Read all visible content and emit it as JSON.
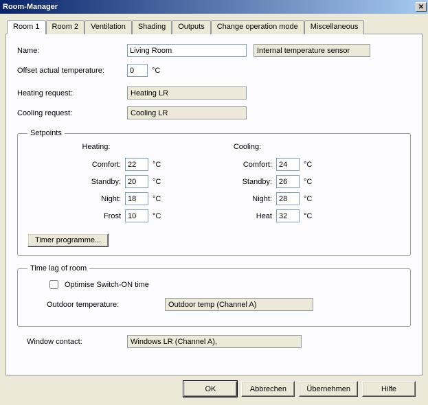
{
  "window": {
    "title": "Room-Manager"
  },
  "tabs": [
    {
      "label": "Room 1"
    },
    {
      "label": "Room 2"
    },
    {
      "label": "Ventilation"
    },
    {
      "label": "Shading"
    },
    {
      "label": "Outputs"
    },
    {
      "label": "Change operation mode"
    },
    {
      "label": "Miscellaneous"
    }
  ],
  "fields": {
    "name_label": "Name:",
    "name_value": "Living Room",
    "temp_sensor_label": "Internal temperature sensor",
    "offset_label": "Offset actual temperature:",
    "offset_value": "0",
    "offset_unit": "°C",
    "heating_req_label": "Heating request:",
    "heating_req_value": "Heating LR",
    "cooling_req_label": "Cooling request:",
    "cooling_req_value": "Cooling LR"
  },
  "setpoints": {
    "legend": "Setpoints",
    "heating_head": "Heating:",
    "cooling_head": "Cooling:",
    "unit": "°C",
    "rows": {
      "comfort_label": "Comfort:",
      "standby_label": "Standby:",
      "night_label": "Night:",
      "frost_label": "Frost",
      "heat_label": "Heat"
    },
    "heating": {
      "comfort": "22",
      "standby": "20",
      "night": "18",
      "frost": "10"
    },
    "cooling": {
      "comfort": "24",
      "standby": "26",
      "night": "28",
      "heat": "32"
    },
    "timer_button": "Timer programme..."
  },
  "timelag": {
    "legend": "Time lag of room",
    "optimise_label": "Optimise Switch-ON time",
    "optimise_checked": false,
    "outdoor_label": "Outdoor temperature:",
    "outdoor_value": "Outdoor temp  (Channel A)"
  },
  "window_contact": {
    "label": "Window contact:",
    "value": "Windows LR  (Channel A),"
  },
  "buttons": {
    "ok": "OK",
    "cancel": "Abbrechen",
    "apply": "Übernehmen",
    "help": "Hilfe"
  }
}
